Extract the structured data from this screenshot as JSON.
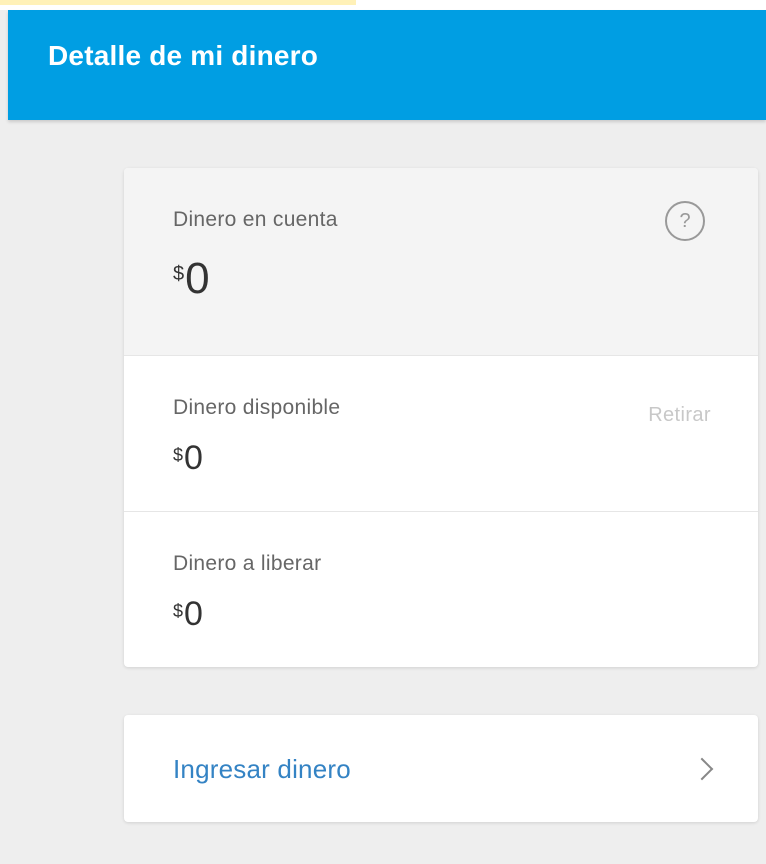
{
  "header": {
    "title": "Detalle de mi dinero"
  },
  "balance": {
    "account": {
      "label": "Dinero en cuenta",
      "currency": "$",
      "value": "0",
      "help_symbol": "?"
    },
    "available": {
      "label": "Dinero disponible",
      "currency": "$",
      "value": "0",
      "action_label": "Retirar"
    },
    "to_release": {
      "label": "Dinero a liberar",
      "currency": "$",
      "value": "0"
    }
  },
  "deposit": {
    "label": "Ingresar dinero"
  },
  "icons": {
    "help": "question-circle-icon",
    "chevron": "chevron-right-icon"
  },
  "colors": {
    "header": "#009ee3",
    "link": "#3483c4",
    "disabled_link": "#c8c8c8",
    "background": "#eeeeee"
  }
}
